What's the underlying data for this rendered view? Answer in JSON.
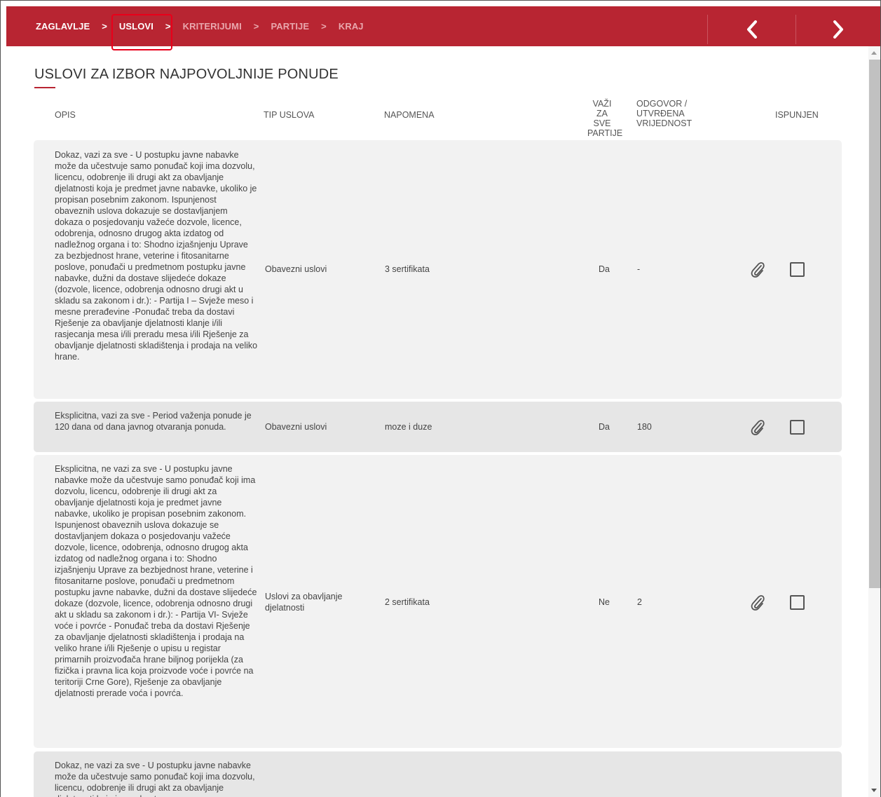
{
  "breadcrumb": {
    "items": [
      {
        "label": "ZAGLAVLJE"
      },
      {
        "label": "USLOVI"
      },
      {
        "label": "KRITERIJUMI"
      },
      {
        "label": "PARTIJE"
      },
      {
        "label": "KRAJ"
      }
    ],
    "separator": ">"
  },
  "nav": {
    "prev_icon": "chevron-left-icon",
    "next_icon": "chevron-right-icon"
  },
  "page": {
    "title": "USLOVI ZA IZBOR NAJPOVOLJNIJE PONUDE"
  },
  "table": {
    "headers": {
      "opis": "OPIS",
      "tip": "TIP USLOVA",
      "napomena": "NAPOMENA",
      "vazi_l1": "VAŽI ZA",
      "vazi_l2": "SVE",
      "vazi_l3": "PARTIJE",
      "odg_l1": "ODGOVOR /",
      "odg_l2": "UTVRĐENA",
      "odg_l3": "VRIJEDNOST",
      "ispunjen": "ISPUNJEN"
    },
    "rows": [
      {
        "opis": "Dokaz, vazi za sve - U postupku javne nabavke može da učestvuje samo ponuđač koji ima dozvolu, licencu, odobrenje ili drugi akt za obavljanje djelatnosti koja je predmet javne nabavke, ukoliko je propisan posebnim zakonom. Ispunjenost obaveznih uslova dokazuje se dostavljanjem dokaza o posjedovanju važeće dozvole, licence, odobrenja, odnosno drugog akta izdatog od nadležnog organa i to: Shodno izjašnjenju Uprave za bezbjednost hrane, veterine i fitosanitarne poslove, ponuđači u predmetnom postupku javne nabavke, dužni da dostave slijedeće dokaze (dozvole, licence, odobrenja odnosno drugi akt u skladu sa zakonom i dr.): - Partija I – Svježe meso i mesne prerađevine -Ponuđač treba da dostavi Rješenje za obavljanje djelatnosti klanje i/ili rasjecanja mesa i/ili preradu mesa i/ili Rješenje za obavljanje djelatnosti skladištenja i prodaja na veliko hrane.",
        "tip": "Obavezni uslovi",
        "napomena": "3 sertifikata",
        "vazi": "Da",
        "odgovor": "-",
        "checked": false
      },
      {
        "opis": "Eksplicitna, vazi za sve - Period važenja ponude je 120 dana od dana javnog otvaranja ponuda.",
        "tip": "Obavezni uslovi",
        "napomena": "moze i duze",
        "vazi": "Da",
        "odgovor": "180",
        "checked": false
      },
      {
        "opis": "Eksplicitna, ne vazi za sve - U postupku javne nabavke može da učestvuje samo ponuđač koji ima dozvolu, licencu, odobrenje ili drugi akt za obavljanje djelatnosti koja je predmet javne nabavke, ukoliko je propisan posebnim zakonom. Ispunjenost obaveznih uslova dokazuje se dostavljanjem dokaza o posjedovanju važeće dozvole, licence, odobrenja, odnosno drugog akta izdatog od nadležnog organa i to: Shodno izjašnjenju Uprave za bezbjednost hrane, veterine i fitosanitarne poslove, ponuđači u predmetnom postupku javne nabavke, dužni da dostave slijedeće dokaze (dozvole, licence, odobrenja odnosno drugi akt u skladu sa zakonom i dr.): - Partija VI- Svježe voće i povrće - Ponuđač treba da dostavi Rješenje za obavljanje djelatnosti skladištenja i prodaja na veliko hrane i/ili Rješenje o upisu u registar primarnih proizvođača hrane biljnog porijekla (za fizička i pravna lica koja proizvode voće i povrće na teritoriji Crne Gore), Rješenje za obavljanje djelatnosti prerade voća i povrća.",
        "tip": "Uslovi za obavljanje djelatnosti",
        "napomena": "2 sertifikata",
        "vazi": "Ne",
        "odgovor": "2",
        "checked": false
      },
      {
        "opis": "Dokaz, ne vazi za sve - U postupku javne nabavke može da učestvuje samo ponuđač koji ima dozvolu, licencu, odobrenje ili drugi akt za obavljanje djelatnosti koja je predmet",
        "tip": "",
        "napomena": "",
        "vazi": "",
        "odgovor": "",
        "checked": false
      }
    ]
  },
  "colors": {
    "brand": "#b82532",
    "highlight": "#e8001a"
  }
}
